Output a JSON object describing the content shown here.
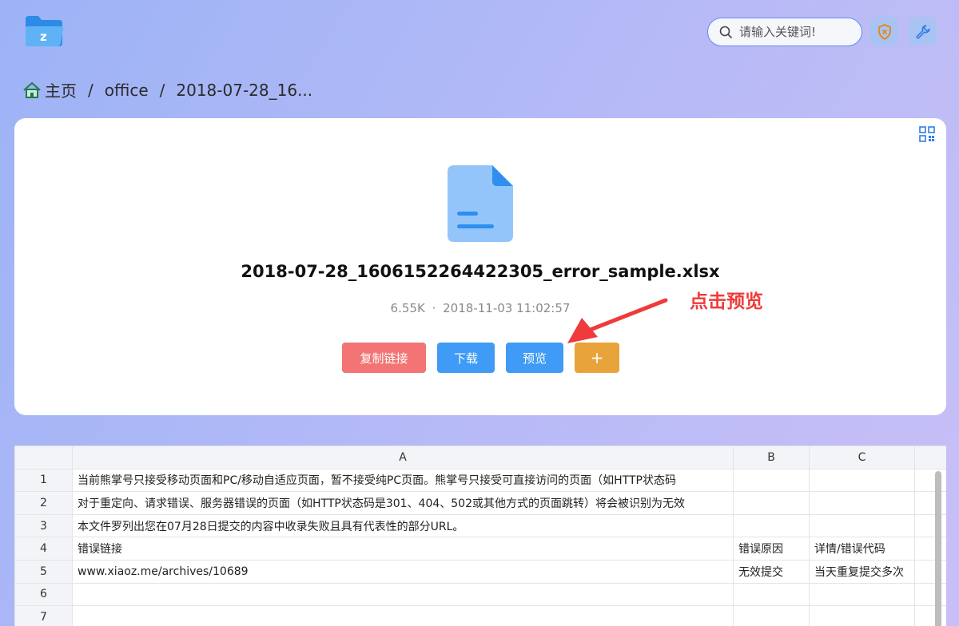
{
  "header": {
    "search": {
      "placeholder": "请输入关键词!",
      "value": ""
    }
  },
  "breadcrumb": {
    "items": [
      "主页",
      "office",
      "2018-07-28_16..."
    ],
    "separator": "/"
  },
  "file": {
    "name": "2018-07-28_1606152264422305_error_sample.xlsx",
    "size": "6.55K",
    "meta_separator": "·",
    "date": "2018-11-03 11:02:57"
  },
  "annotation": {
    "text": "点击预览"
  },
  "actions": {
    "copy_link": "复制链接",
    "download": "下载",
    "preview": "预览",
    "more": "+"
  },
  "spreadsheet": {
    "columns": [
      "A",
      "B",
      "C"
    ],
    "rows": [
      {
        "num": "1",
        "cells": [
          "当前熊掌号只接受移动页面和PC/移动自适应页面，暂不接受纯PC页面。熊掌号只接受可直接访问的页面（如HTTP状态码",
          "",
          ""
        ]
      },
      {
        "num": "2",
        "cells": [
          "对于重定向、请求错误、服务器错误的页面（如HTTP状态码是301、404、502或其他方式的页面跳转）将会被识别为无效",
          "",
          ""
        ]
      },
      {
        "num": "3",
        "cells": [
          "本文件罗列出您在07月28日提交的内容中收录失败且具有代表性的部分URL。",
          "",
          ""
        ]
      },
      {
        "num": "4",
        "cells": [
          "错误链接",
          "错误原因",
          "详情/错误代码"
        ]
      },
      {
        "num": "5",
        "cells": [
          "www.xiaoz.me/archives/10689",
          "无效提交",
          "当天重复提交多次"
        ]
      },
      {
        "num": "6",
        "cells": [
          "",
          "",
          ""
        ]
      },
      {
        "num": "7",
        "cells": [
          "",
          "",
          ""
        ]
      }
    ]
  },
  "colors": {
    "accent": "#3f9bf5",
    "danger": "#f27474",
    "warning": "#e8a33b",
    "annotation": "#ef3b3b"
  },
  "icons": {
    "logo": "folder-z-logo",
    "search": "search-icon",
    "shield": "shield-icon",
    "wrench": "wrench-icon",
    "home": "home-icon",
    "qr": "qrcode-icon",
    "file": "document-icon"
  }
}
